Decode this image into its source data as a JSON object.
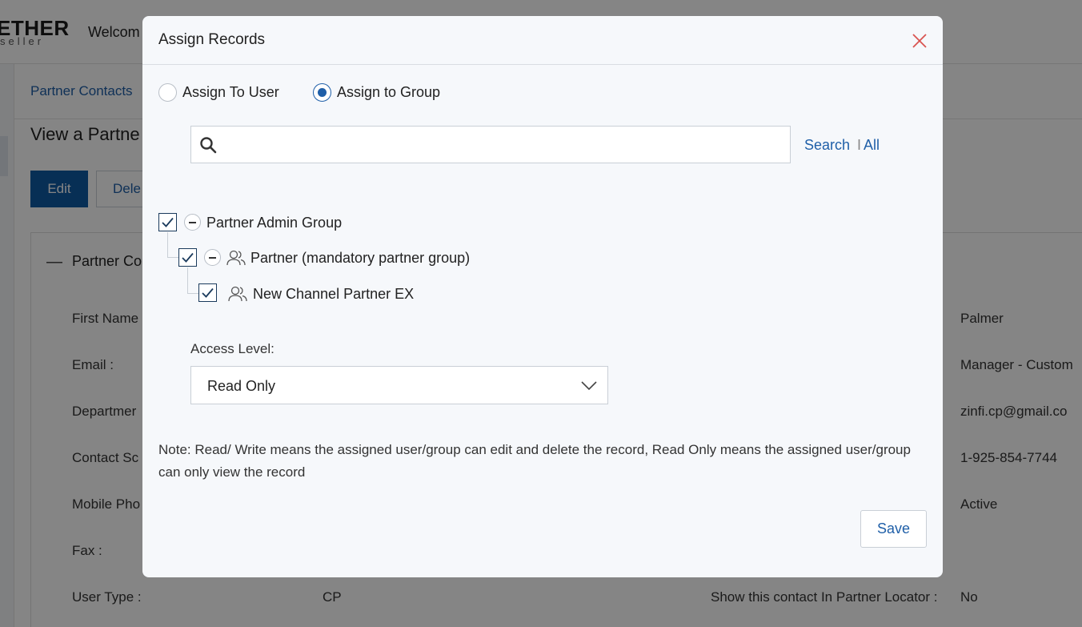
{
  "background": {
    "logo": {
      "main": "ETHER",
      "sub": "seller"
    },
    "welcome": "Welcom",
    "breadcrumb": "Partner Contacts",
    "page_title": "View a Partne",
    "buttons": {
      "edit": "Edit",
      "delete": "Dele"
    },
    "panel_title": "Partner Co",
    "fields_left": [
      {
        "label": "First Name"
      },
      {
        "label": "Email :"
      },
      {
        "label": "Departmer"
      },
      {
        "label": "Contact Sc"
      },
      {
        "label": "Mobile Pho"
      },
      {
        "label": "Fax :"
      },
      {
        "label": "User Type :"
      }
    ],
    "user_type_value": "CP",
    "fields_right_values": [
      "Palmer",
      "Manager - Custom",
      "zinfi.cp@gmail.co",
      "1-925-854-7744",
      "Active"
    ],
    "locator_label": "Show this contact In Partner Locator :",
    "locator_value": "No"
  },
  "modal": {
    "title": "Assign Records",
    "assign_options": [
      {
        "label": "Assign To User",
        "selected": false
      },
      {
        "label": "Assign to Group",
        "selected": true
      }
    ],
    "search": {
      "value": "",
      "placeholder": "",
      "search_link": "Search",
      "separator": "I",
      "all_link": "All"
    },
    "tree": [
      {
        "label": "Partner Admin Group",
        "checked": true,
        "expanded": true,
        "icon": ""
      },
      {
        "label": "Partner (mandatory partner group)",
        "checked": true,
        "expanded": true,
        "icon": "users-icon"
      },
      {
        "label": "New Channel Partner EX",
        "checked": true,
        "icon": "users-icon"
      }
    ],
    "access_level": {
      "label": "Access Level:",
      "selected": "Read Only"
    },
    "note": "Note: Read/ Write means the assigned user/group can edit and delete the record, Read Only means the assigned user/group can only view the record",
    "save_label": "Save"
  },
  "colors": {
    "accent": "#1f5fa8",
    "close_icon": "#d9534f",
    "overlay": "rgba(0,0,0,0.48)"
  }
}
